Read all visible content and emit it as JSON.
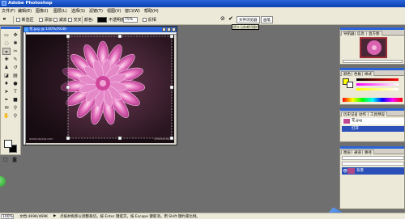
{
  "app": {
    "title": "Adobe Photoshop"
  },
  "menu": [
    "文件(F)",
    "编辑(E)",
    "图像(I)",
    "图层(L)",
    "选择(S)",
    "滤镜(T)",
    "视图(V)",
    "窗口(W)",
    "帮助(H)"
  ],
  "options": {
    "items": [
      "新选区",
      "添加",
      "减去",
      "交叉",
      "羽化:",
      "消除锯齿",
      "样式:",
      "颜色:",
      "不透明度:",
      "反相"
    ],
    "opacity": "75%",
    "invert_label": "反相",
    "tab_file_browser": "文件浏览器",
    "tab_brushes": "画笔"
  },
  "tooltip": "提交当前裁切操作",
  "document": {
    "title": "花.jpg @ 100%(RGB)",
    "watermark_left": "www.pspaiq.com",
    "watermark_right": "photoshop"
  },
  "panels": {
    "navigator": [
      "导航器",
      "信息",
      "直方图"
    ],
    "color": [
      "颜色",
      "色板",
      "样式"
    ],
    "history": [
      "历史记录",
      "动作",
      "工具预设"
    ],
    "history_items": [
      "花.jpg",
      "打开"
    ],
    "layers": [
      "图层",
      "通道",
      "路径"
    ],
    "layer_name": "背景"
  },
  "status": {
    "zoom": "100%",
    "doc": "文档:469K/469K",
    "hint": "点按并拖移以调整裁切。按 Enter 键提交，按 Escape 键取消。用 Shift 键约束比例。"
  },
  "colors": {
    "titlebar": "#0a3fb0",
    "workspace": "#6f6f6f",
    "panel": "#ece9d8",
    "selected": "#2a4fb8"
  }
}
